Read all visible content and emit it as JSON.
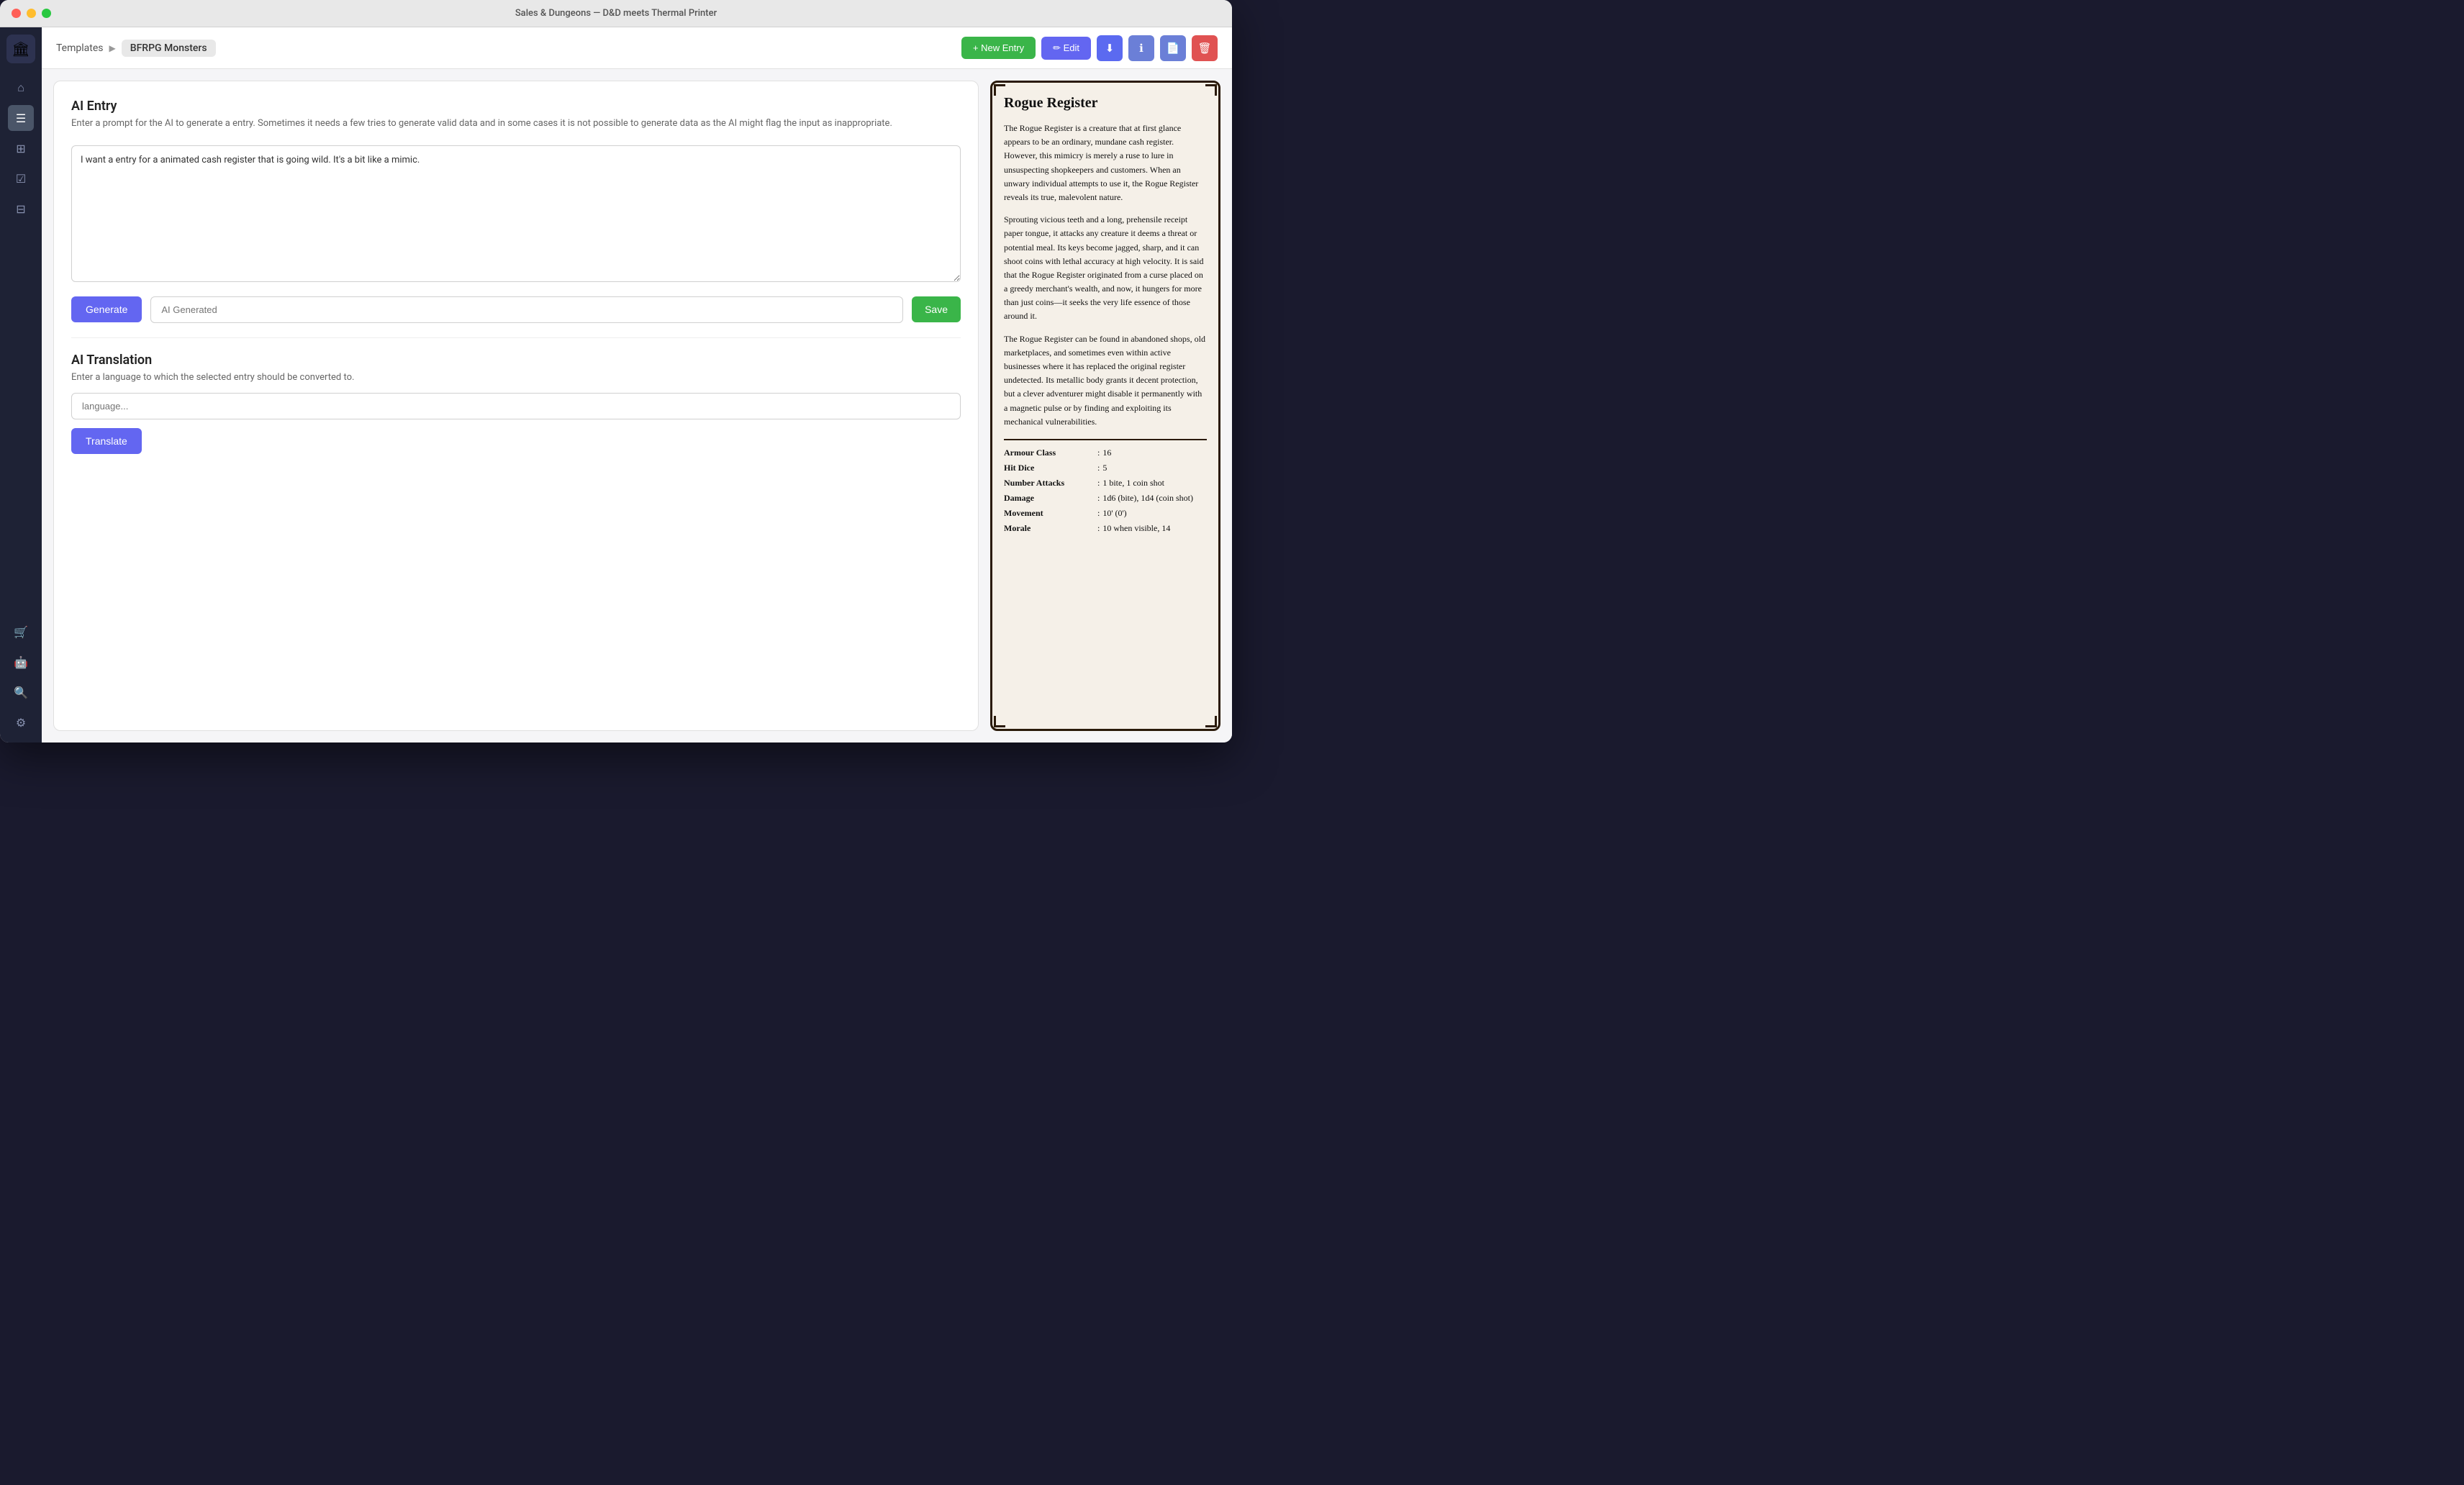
{
  "window": {
    "title": "Sales & Dungeons — D&D meets Thermal Printer"
  },
  "breadcrumb": {
    "link": "Templates",
    "separator": "▶",
    "current": "BFRPG Monsters"
  },
  "toolbar": {
    "new_entry_label": "+ New Entry",
    "edit_label": "✏ Edit"
  },
  "ai_entry": {
    "title": "AI Entry",
    "description": "Enter a prompt for the AI to generate a entry. Sometimes it needs a few tries to generate valid data and in some cases it is not possible to generate data as the AI might flag the input as inappropriate.",
    "prompt_text": "I want a entry for a animated cash register that is going wild. It's a bit like a mimic.",
    "generate_label": "Generate",
    "ai_generated_placeholder": "AI Generated",
    "save_label": "Save"
  },
  "ai_translation": {
    "title": "AI Translation",
    "description": "Enter a language to which the selected entry should be converted to.",
    "language_placeholder": "language...",
    "translate_label": "Translate"
  },
  "preview_card": {
    "title": "Rogue Register",
    "paragraphs": [
      "The Rogue Register is a creature that at first glance appears to be an ordinary, mundane cash register. However, this mimicry is merely a ruse to lure in unsuspecting shopkeepers and customers. When an unwary individual attempts to use it, the Rogue Register reveals its true, malevolent nature.",
      "Sprouting vicious teeth and a long, prehensile receipt paper tongue, it attacks any creature it deems a threat or potential meal. Its keys become jagged, sharp, and it can shoot coins with lethal accuracy at high velocity. It is said that the Rogue Register originated from a curse placed on a greedy merchant's wealth, and now, it hungers for more than just coins—it seeks the very life essence of those around it.",
      "The Rogue Register can be found in abandoned shops, old marketplaces, and sometimes even within active businesses where it has replaced the original register undetected. Its metallic body grants it decent protection, but a clever adventurer might disable it permanently with a magnetic pulse or by finding and exploiting its mechanical vulnerabilities."
    ],
    "stats": [
      {
        "label": "Armour Class",
        "value": "16"
      },
      {
        "label": "Hit Dice",
        "value": "5"
      },
      {
        "label": "Number Attacks",
        "value": "1 bite, 1 coin shot"
      },
      {
        "label": "Damage",
        "value": "1d6 (bite), 1d4 (coin shot)"
      },
      {
        "label": "Movement",
        "value": "10' (0')"
      },
      {
        "label": "Morale",
        "value": "10 when visible, 14"
      }
    ]
  },
  "sidebar": {
    "icons": [
      {
        "name": "home-icon",
        "symbol": "⌂",
        "active": false
      },
      {
        "name": "document-icon",
        "symbol": "☰",
        "active": true
      },
      {
        "name": "people-icon",
        "symbol": "⊞",
        "active": false
      },
      {
        "name": "form-icon",
        "symbol": "☑",
        "active": false
      },
      {
        "name": "cart-icon",
        "symbol": "⊡",
        "active": false
      },
      {
        "name": "robot-icon",
        "symbol": "⊙",
        "active": false
      },
      {
        "name": "settings-icon",
        "symbol": "⚙",
        "active": false
      }
    ]
  }
}
